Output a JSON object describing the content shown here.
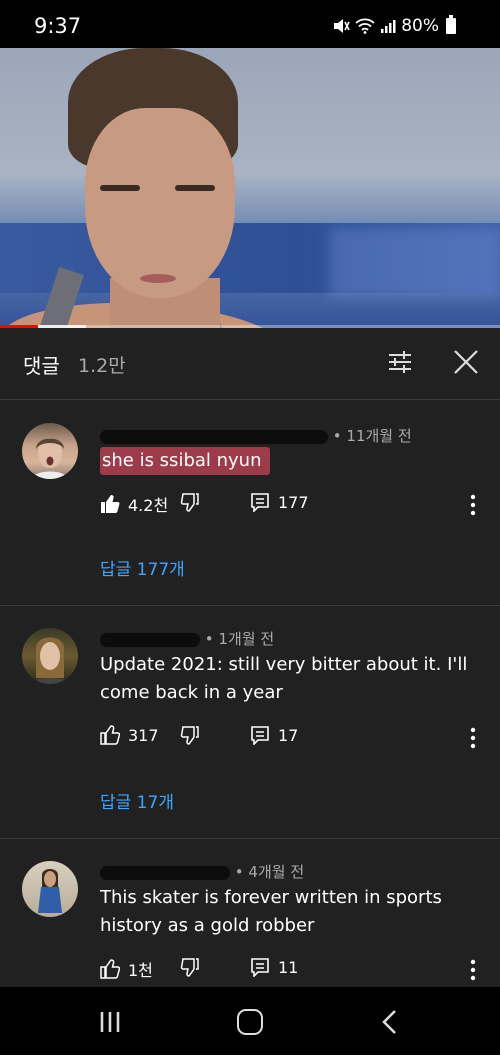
{
  "status_bar": {
    "time": "9:37",
    "battery": "80%",
    "icons": [
      "mute-icon",
      "wifi-icon",
      "signal-icon",
      "battery-icon"
    ]
  },
  "video": {
    "progress_played_fraction": 0.076,
    "progress_buffered_fraction": 0.172
  },
  "comments_panel": {
    "title": "댓글",
    "count": "1.2만",
    "icons": [
      "filter-icon",
      "close-icon"
    ]
  },
  "comments": [
    {
      "username": "",
      "time": "11개월 전",
      "text": "she is ssibal nyun",
      "likes": "4.2천",
      "replies_count": "177",
      "replies_label": "답글 177개",
      "liked": true
    },
    {
      "username": "",
      "time": "1개월 전",
      "text": "Update 2021: still very bitter about it. I'll come back in a year",
      "likes": "317",
      "replies_count": "17",
      "replies_label": "답글 17개",
      "liked": false
    },
    {
      "username": "",
      "time": "4개월 전",
      "text": "This skater is forever written in sports history as a gold robber",
      "likes": "1천",
      "replies_count": "11",
      "liked": false
    }
  ],
  "colors": {
    "background": "#212121",
    "link": "#3ea6ff",
    "highlight": "#9e3b4a",
    "progress": "#ff0000"
  }
}
